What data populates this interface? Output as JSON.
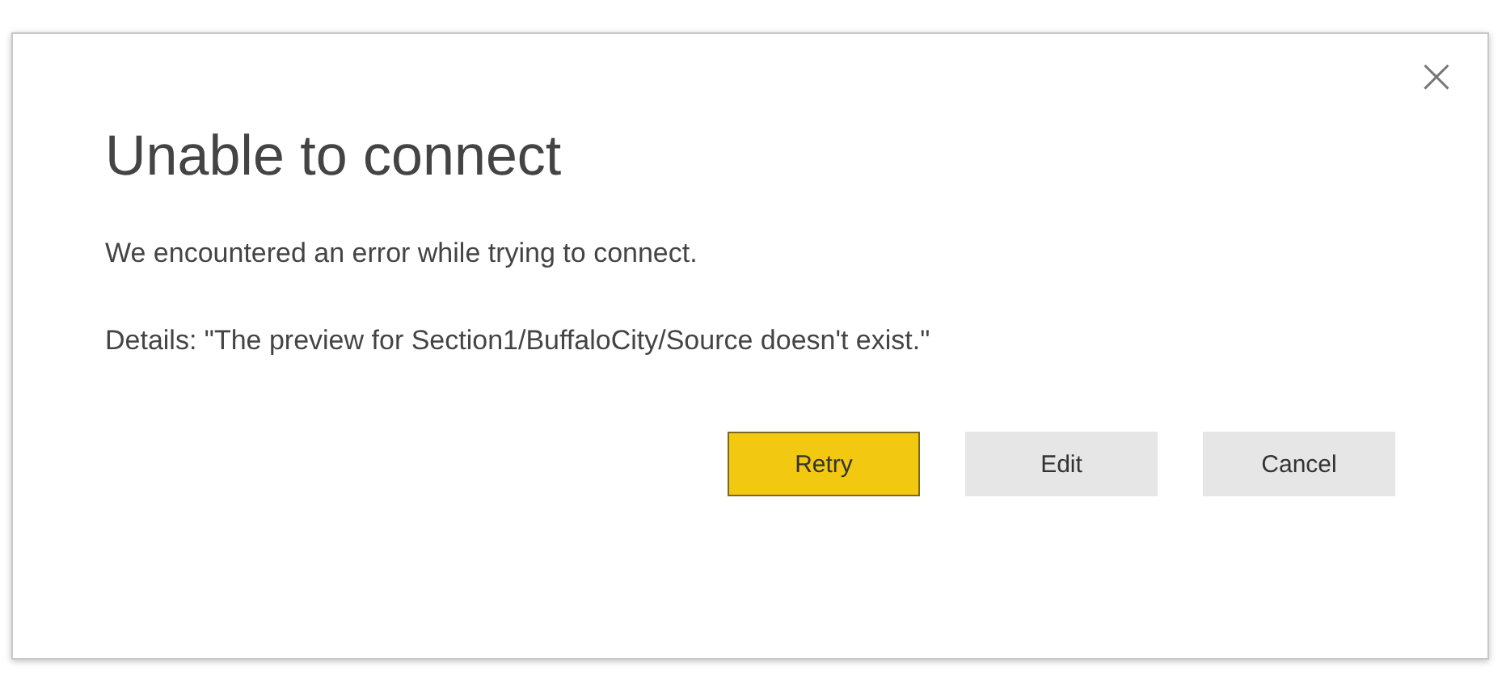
{
  "dialog": {
    "close": "×",
    "title": "Unable to connect",
    "message": "We encountered an error while trying to connect.",
    "details": "Details: \"The preview for Section1/BuffaloCity/Source doesn't exist.\"",
    "buttons": [
      {
        "label": "Retry",
        "kind": "primary"
      },
      {
        "label": "Edit",
        "kind": "secondary"
      },
      {
        "label": "Cancel",
        "kind": "secondary"
      }
    ]
  }
}
